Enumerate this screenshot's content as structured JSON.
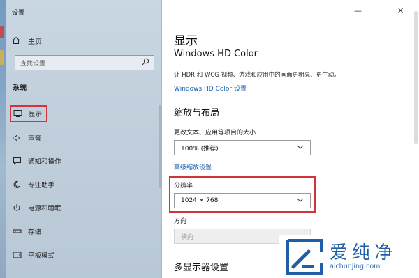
{
  "window": {
    "title": "设置",
    "minimize": "—",
    "maximize": "☐",
    "close": "✕"
  },
  "sidebar": {
    "home_label": "主页",
    "search_placeholder": "查找设置",
    "section_title": "系统",
    "items": [
      {
        "label": "显示",
        "icon": "monitor-icon",
        "active": true
      },
      {
        "label": "声音",
        "icon": "speaker-icon"
      },
      {
        "label": "通知和操作",
        "icon": "notification-icon"
      },
      {
        "label": "专注助手",
        "icon": "moon-icon"
      },
      {
        "label": "电源和睡眠",
        "icon": "power-icon"
      },
      {
        "label": "存储",
        "icon": "storage-icon"
      },
      {
        "label": "平板模式",
        "icon": "tablet-icon"
      }
    ]
  },
  "main": {
    "page_title": "显示",
    "hd_color": {
      "title": "Windows HD Color",
      "description": "让 HDR 和 WCG 视频、游戏和应用中的画面更明亮、更生动。",
      "link": "Windows HD Color 设置"
    },
    "scale_layout": {
      "title": "缩放与布局",
      "text_size_label": "更改文本、应用等项目的大小",
      "text_size_value": "100% (推荐)",
      "advanced_link": "高级缩放设置",
      "resolution_label": "分辨率",
      "resolution_value": "1024 × 768",
      "orientation_label": "方向",
      "orientation_value": "横向"
    },
    "multi_display_title": "多显示器设置"
  },
  "watermark": {
    "brand": "爱纯净",
    "url": "aichunjing.com"
  },
  "colors": {
    "accent_link": "#1a63b4",
    "highlight_box": "#d1343b",
    "brand_blue": "#1f5fa8"
  }
}
